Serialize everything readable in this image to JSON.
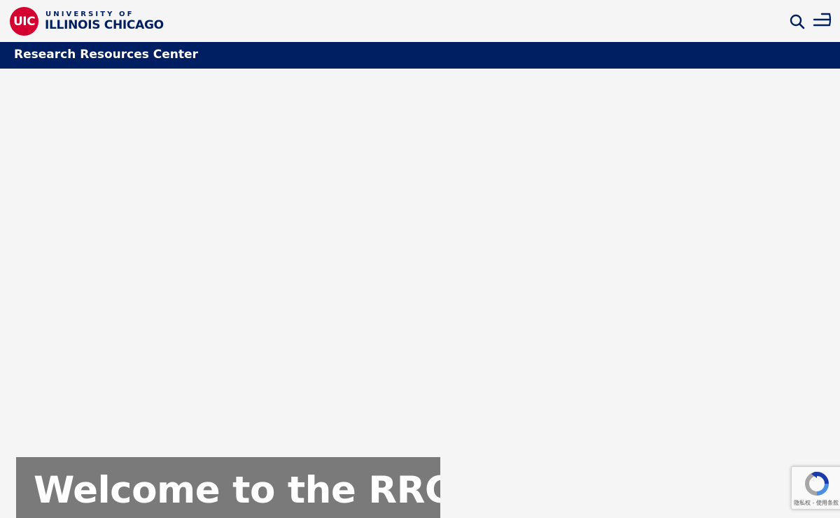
{
  "header": {
    "logo_mark": "UIC",
    "logo_line1": "UNIVERSITY OF",
    "logo_line2": "ILLINOIS CHICAGO",
    "search_icon": "search-icon",
    "menu_icon": "menu-icon"
  },
  "site": {
    "title": "Research Resources Center"
  },
  "hero": {
    "title": "Welcome to the RRC"
  },
  "recaptcha": {
    "links": "隐私权 - 使用条款"
  },
  "colors": {
    "brand_red": "#d50032",
    "brand_navy": "#001e62",
    "background": "#f5f5f5",
    "hero_box": "#7a7a7a"
  }
}
